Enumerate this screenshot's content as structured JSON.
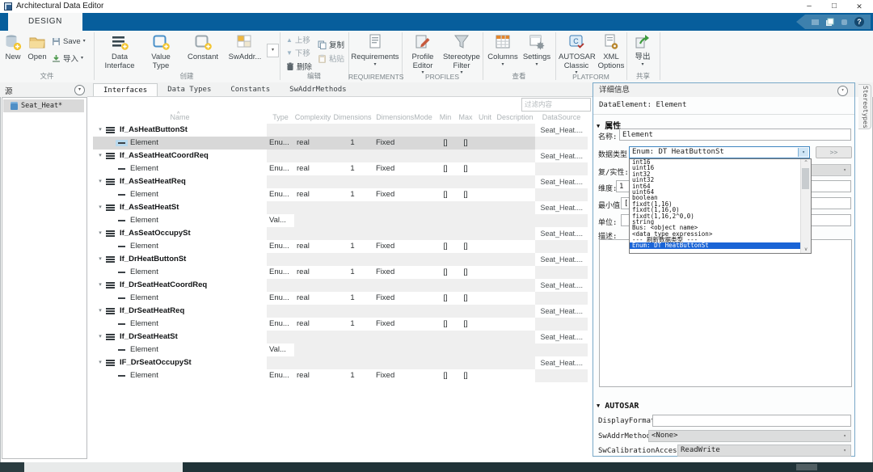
{
  "titlebar": {
    "title": "Architectural Data Editor",
    "minimize": "–",
    "maximize": "□",
    "close": "✕"
  },
  "icons": {
    "sort": "^",
    "caret": "▾",
    "chevron": "▾",
    "help": "?",
    "up": "▲",
    "down": "▼",
    "section": "▼"
  },
  "ribbon": {
    "tab": "DESIGN",
    "groups": {
      "file": {
        "label": "文件",
        "new": "New",
        "open": "Open",
        "save": "Save",
        "import": "导入"
      },
      "create": {
        "label": "创建",
        "data_interface": "Data Interface",
        "value_type": "Value Type",
        "constant": "Constant",
        "swaddr": "SwAddr..."
      },
      "edit": {
        "label": "编辑",
        "up": "上移",
        "down": "下移",
        "delete": "删除",
        "copy": "复制",
        "paste": "粘贴"
      },
      "requirements": {
        "label": "REQUIREMENTS",
        "button": "Requirements"
      },
      "profiles": {
        "label": "PROFILES",
        "profile_editor": "Profile Editor",
        "stereotype_filter": "Stereotype Filter"
      },
      "view": {
        "label": "查看",
        "columns": "Columns",
        "settings": "Settings"
      },
      "platform": {
        "label": "PLATFORM",
        "autosar_classic": "AUTOSAR Classic",
        "xml_options": "XML Options"
      },
      "share": {
        "label": "共享",
        "export": "导出"
      }
    }
  },
  "source_panel": {
    "header": "源",
    "items": [
      {
        "label": "Seat_Heat*"
      }
    ]
  },
  "tabs": [
    {
      "label": "Interfaces",
      "active": true
    },
    {
      "label": "Data Types"
    },
    {
      "label": "Constants"
    },
    {
      "label": "SwAddrMethods"
    }
  ],
  "filter": {
    "placeholder": "过滤内容"
  },
  "table": {
    "headers": [
      "Name",
      "Type",
      "Complexity",
      "Dimensions",
      "DimensionsMode",
      "Min",
      "Max",
      "Unit",
      "Description",
      "DataSource"
    ],
    "rows": [
      {
        "kind": "group",
        "name": "If_AsHeatButtonSt",
        "datasource": "Seat_Heat...."
      },
      {
        "kind": "element",
        "name": "Element",
        "type": "Enu...",
        "complexity": "real",
        "dimensions": "1",
        "mode": "Fixed",
        "min": "[]",
        "max": "[]",
        "selected": true
      },
      {
        "kind": "group",
        "name": "If_AsSeatHeatCoordReq",
        "datasource": "Seat_Heat...."
      },
      {
        "kind": "element",
        "name": "Element",
        "type": "Enu...",
        "complexity": "real",
        "dimensions": "1",
        "mode": "Fixed",
        "min": "[]",
        "max": "[]"
      },
      {
        "kind": "group",
        "name": "If_AsSeatHeatReq",
        "datasource": "Seat_Heat...."
      },
      {
        "kind": "element",
        "name": "Element",
        "type": "Enu...",
        "complexity": "real",
        "dimensions": "1",
        "mode": "Fixed",
        "min": "[]",
        "max": "[]"
      },
      {
        "kind": "group",
        "name": "If_AsSeatHeatSt",
        "datasource": "Seat_Heat...."
      },
      {
        "kind": "element",
        "name": "Element",
        "type": "Val..."
      },
      {
        "kind": "group",
        "name": "If_AsSeatOccupySt",
        "datasource": "Seat_Heat...."
      },
      {
        "kind": "element",
        "name": "Element",
        "type": "Enu...",
        "complexity": "real",
        "dimensions": "1",
        "mode": "Fixed",
        "min": "[]",
        "max": "[]"
      },
      {
        "kind": "group",
        "name": "If_DrHeatButtonSt",
        "datasource": "Seat_Heat...."
      },
      {
        "kind": "element",
        "name": "Element",
        "type": "Enu...",
        "complexity": "real",
        "dimensions": "1",
        "mode": "Fixed",
        "min": "[]",
        "max": "[]"
      },
      {
        "kind": "group",
        "name": "If_DrSeatHeatCoordReq",
        "datasource": "Seat_Heat...."
      },
      {
        "kind": "element",
        "name": "Element",
        "type": "Enu...",
        "complexity": "real",
        "dimensions": "1",
        "mode": "Fixed",
        "min": "[]",
        "max": "[]"
      },
      {
        "kind": "group",
        "name": "If_DrSeatHeatReq",
        "datasource": "Seat_Heat...."
      },
      {
        "kind": "element",
        "name": "Element",
        "type": "Enu...",
        "complexity": "real",
        "dimensions": "1",
        "mode": "Fixed",
        "min": "[]",
        "max": "[]"
      },
      {
        "kind": "group",
        "name": "If_DrSeatHeatSt",
        "datasource": "Seat_Heat...."
      },
      {
        "kind": "element",
        "name": "Element",
        "type": "Val..."
      },
      {
        "kind": "group",
        "name": "IF_DrSeatOccupySt",
        "datasource": "Seat_Heat...."
      },
      {
        "kind": "element",
        "name": "Element",
        "type": "Enu...",
        "complexity": "real",
        "dimensions": "1",
        "mode": "Fixed",
        "min": "[]",
        "max": "[]"
      }
    ]
  },
  "details": {
    "header": "详细信息",
    "subject": "DataElement: Element",
    "properties_section": "属性",
    "name_label": "名称:",
    "name_value": "Element",
    "datatype_label": "数据类型:",
    "datatype_value": "Enum: DT HeatButtonSt",
    "more_button": ">>",
    "complexity_label": "复/实性:",
    "dimensions_label": "维度:",
    "dimensions_value": "1",
    "min_label": "最小值:",
    "min_value": "[]",
    "unit_label": "单位:",
    "description_label": "描述:",
    "autosar_section": "AUTOSAR",
    "display_format_label": "DisplayFormat:",
    "sw_addr_method_label": "SwAddrMethod:",
    "sw_addr_method_value": "<None>",
    "sw_calibration_label": "SwCalibrationAccess:",
    "sw_calibration_value": "ReadWrite",
    "datatype_dropdown": {
      "items": [
        "int16",
        "uint16",
        "int32",
        "uint32",
        "int64",
        "uint64",
        "boolean",
        "fixdt(1,16)",
        "fixdt(1,16,0)",
        "fixdt(1,16,2^0,0)",
        "string",
        "Bus: <object name>",
        "<data type expression>",
        "--- 刷新数据类型 ---"
      ],
      "selected": "Enum: DT HeatButtonSt"
    }
  },
  "side_tab": "Stereotypes",
  "colors": {
    "ribbon_blue": "#075e9c",
    "selection_blue": "#1a64d6",
    "taskbar": "#203338"
  }
}
